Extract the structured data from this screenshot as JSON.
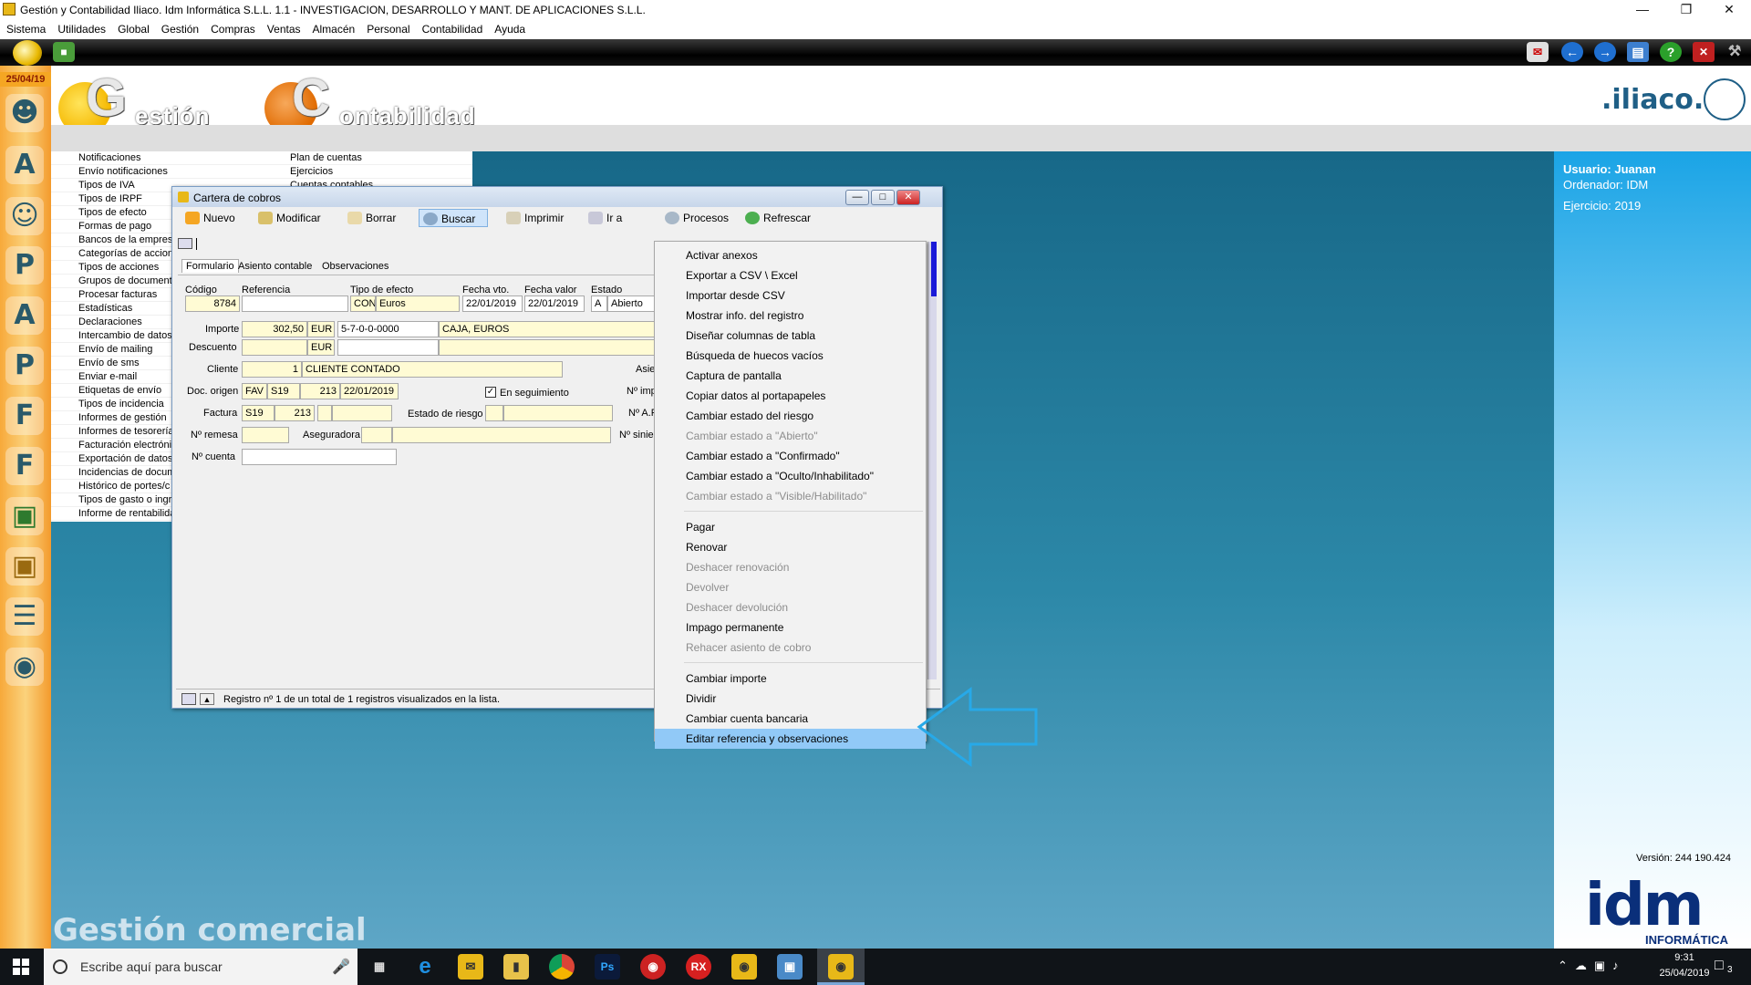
{
  "window": {
    "title": "Gestión y Contabilidad Iliaco. Idm Informática S.L.L. 1.1 - INVESTIGACION, DESARROLLO Y MANT. DE APLICACIONES S.L.L."
  },
  "menubar": [
    "Sistema",
    "Utilidades",
    "Global",
    "Gestión",
    "Compras",
    "Ventas",
    "Almacén",
    "Personal",
    "Contabilidad",
    "Ayuda"
  ],
  "date": "25/04/19",
  "logos": {
    "gestion": "estión",
    "gestion_letter": "G",
    "contabilidad": "ontabilidad",
    "contabilidad_letter": "C",
    "brand": ".iliaco."
  },
  "user": {
    "usuario": "Usuario: Juanan",
    "ordenador": "Ordenador: IDM",
    "ejercicio": "Ejercicio: 2019",
    "version": "Versión: 244 190.424"
  },
  "idm": {
    "big": "idm",
    "small": "INFORMÁTICA"
  },
  "footer_label": "Gestión comercial",
  "menu_col1": [
    "Notificaciones",
    "Envío notificaciones",
    "Tipos de IVA",
    "Tipos de IRPF",
    "Tipos de efecto",
    "Formas de pago",
    "Bancos de la empresa",
    "Categorías de acciones",
    "Tipos de acciones",
    "Grupos de documentos",
    "Procesar facturas",
    "Estadísticas",
    "Declaraciones",
    "Intercambio de datos",
    "Envío de mailing",
    "Envío de sms",
    "Enviar e-mail",
    "Etiquetas de envío",
    "Tipos de incidencia",
    "Informes de gestión",
    "Informes de tesorería",
    "Facturación electrónica",
    "Exportación de datos",
    "Incidencias de documentos",
    "Histórico de portes/c",
    "Tipos de gasto o ingreso",
    "Informe de rentabilidad"
  ],
  "menu_col2": [
    "Plan de cuentas",
    "Ejercicios",
    "Cuentas contables"
  ],
  "dialog": {
    "title": "Cartera de cobros",
    "toolbar": [
      "Nuevo",
      "Modificar",
      "Borrar",
      "Buscar",
      "Imprimir",
      "Ir a",
      "Procesos",
      "Refrescar"
    ],
    "tabs": [
      "Formulario",
      "Asiento contable",
      "Observaciones"
    ],
    "labels": {
      "codigo": "Código",
      "referencia": "Referencia",
      "tipo_efecto": "Tipo de efecto",
      "fecha_vto": "Fecha vto.",
      "fecha_valor": "Fecha valor",
      "estado": "Estado",
      "importe": "Importe",
      "descuento": "Descuento",
      "cliente": "Cliente",
      "doc_origen": "Doc. origen",
      "factura": "Factura",
      "estado_riesgo": "Estado de riesgo",
      "n_remesa": "Nº remesa",
      "aseguradora": "Aseguradora",
      "n_cuenta": "Nº cuenta",
      "en_seguimiento": "En seguimiento",
      "asie": "Asie",
      "n_impa": "Nº impa",
      "n_af": "Nº A.F",
      "n_sinie": "Nº sinie"
    },
    "values": {
      "codigo": "8784",
      "tipo_code": "CON",
      "tipo_name": "Euros",
      "fecha_vto": "22/01/2019",
      "fecha_valor": "22/01/2019",
      "estado_code": "A",
      "estado_name": "Abierto",
      "importe": "302,50",
      "importe_cur": "EUR",
      "cuenta_code": "5-7-0-0-0000",
      "cuenta_name": "CAJA, EUROS",
      "descuento_cur": "EUR",
      "cliente_num": "1",
      "cliente_name": "CLIENTE CONTADO",
      "doc_tipo": "FAV",
      "doc_serie": "S19",
      "doc_num": "213",
      "doc_fecha": "22/01/2019",
      "fac_serie": "S19",
      "fac_num": "213"
    },
    "status": "Registro nº 1 de un total de 1 registros visualizados en la lista."
  },
  "context_menu": {
    "groups": [
      [
        {
          "label": "Activar anexos",
          "enabled": true
        },
        {
          "label": "Exportar a CSV \\ Excel",
          "enabled": true
        },
        {
          "label": "Importar desde CSV",
          "enabled": true
        },
        {
          "label": "Mostrar info. del registro",
          "enabled": true
        },
        {
          "label": "Diseñar columnas de tabla",
          "enabled": true
        },
        {
          "label": "Búsqueda de huecos vacíos",
          "enabled": true
        },
        {
          "label": "Captura de pantalla",
          "enabled": true
        },
        {
          "label": "Copiar datos al portapapeles",
          "enabled": true
        },
        {
          "label": "Cambiar estado del riesgo",
          "enabled": true
        },
        {
          "label": "Cambiar estado a \"Abierto\"",
          "enabled": false
        },
        {
          "label": "Cambiar estado a \"Confirmado\"",
          "enabled": true
        },
        {
          "label": "Cambiar estado a \"Oculto/Inhabilitado\"",
          "enabled": true
        },
        {
          "label": "Cambiar estado a \"Visible/Habilitado\"",
          "enabled": false
        }
      ],
      [
        {
          "label": "Pagar",
          "enabled": true
        },
        {
          "label": "Renovar",
          "enabled": true
        },
        {
          "label": "Deshacer renovación",
          "enabled": false
        },
        {
          "label": "Devolver",
          "enabled": false
        },
        {
          "label": "Deshacer devolución",
          "enabled": false
        },
        {
          "label": "Impago permanente",
          "enabled": true
        },
        {
          "label": "Rehacer asiento de cobro",
          "enabled": false
        }
      ],
      [
        {
          "label": "Cambiar importe",
          "enabled": true
        },
        {
          "label": "Dividir",
          "enabled": true
        },
        {
          "label": "Cambiar cuenta bancaria",
          "enabled": true
        },
        {
          "label": "Editar referencia y observaciones",
          "enabled": true,
          "highlighted": true
        }
      ]
    ]
  },
  "taskbar": {
    "search_placeholder": "Escribe aquí para buscar",
    "time": "9:31",
    "date": "25/04/2019",
    "notif_count": "3"
  },
  "colors": {
    "accent_blue": "#1aa4e6",
    "selected_item": "#91c9f7",
    "main_bg": "#2c88a8",
    "left_strip": "#f7a93a"
  }
}
